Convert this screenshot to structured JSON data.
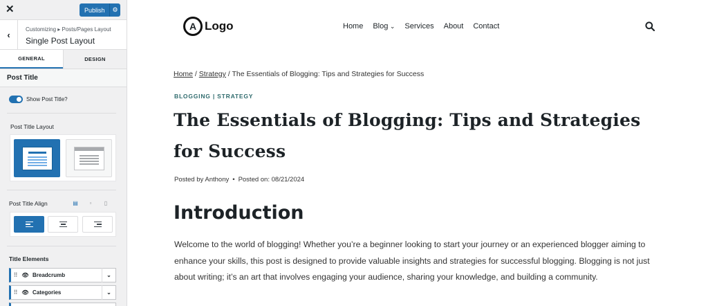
{
  "sidebar": {
    "close_glyph": "✕",
    "publish_label": "Publish",
    "breadcrumb": "Customizing ▸ Posts/Pages Layout",
    "title": "Single Post Layout",
    "tabs": [
      {
        "label": "GENERAL"
      },
      {
        "label": "DESIGN"
      }
    ],
    "section_title": "Post Title",
    "show_title_label": "Show Post Title?",
    "show_title_on": true,
    "layout_label": "Post Title Layout",
    "align_label": "Post Title Align",
    "elements_label": "Title Elements",
    "elements": [
      {
        "label": "Breadcrumb"
      },
      {
        "label": "Categories"
      }
    ]
  },
  "site": {
    "logo_letter": "A",
    "logo_text": "Logo",
    "nav": [
      {
        "label": "Home"
      },
      {
        "label": "Blog"
      },
      {
        "label": "Services"
      },
      {
        "label": "About"
      },
      {
        "label": "Contact"
      }
    ],
    "breadcrumb": {
      "home": "Home",
      "sep1": " / ",
      "cat": "Strategy",
      "sep2": " / ",
      "current": "The Essentials of Blogging: Tips and Strategies for Success"
    },
    "categories": "BLOGGING | STRATEGY",
    "title": "The Essentials of Blogging: Tips and Strategies for Success",
    "meta": {
      "author": "Posted by Anthony",
      "dot": "•",
      "date": "Posted on: 08/21/2024"
    },
    "intro_heading": "Introduction",
    "intro_text": "Welcome to the world of blogging! Whether you’re a beginner looking to start your journey or an experienced blogger aiming to enhance your skills, this post is designed to provide valuable insights and strategies for successful blogging. Blogging is not just about writing; it’s an art that involves engaging your audience, sharing your knowledge, and building a community."
  },
  "colors": {
    "accent": "#2271b1",
    "category": "#2f6b6d"
  }
}
